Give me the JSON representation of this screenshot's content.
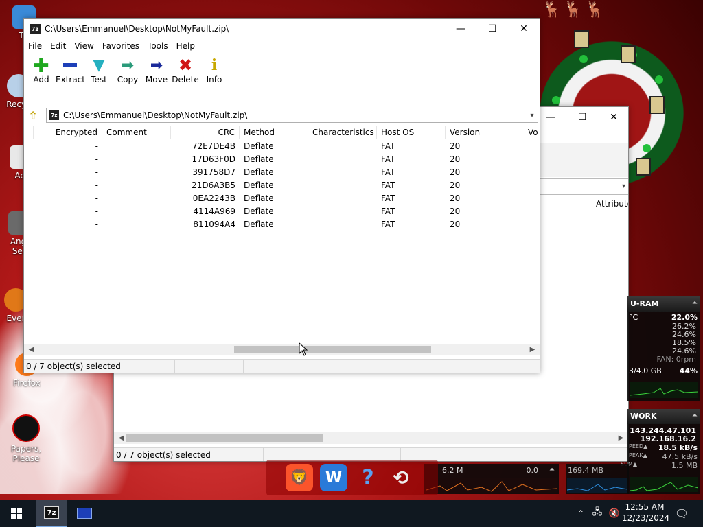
{
  "desktop": {
    "icons": [
      {
        "label": "Th"
      },
      {
        "label": "Recyc"
      },
      {
        "label": "Act"
      },
      {
        "label": "Angr"
      },
      {
        "label": "Sea"
      },
      {
        "label": "Ever"
      },
      {
        "label": "Firefox"
      },
      {
        "label": "Papers, Please"
      }
    ]
  },
  "front_window": {
    "title": "C:\\Users\\Emmanuel\\Desktop\\NotMyFault.zip\\",
    "logo": "7z",
    "menu": [
      "File",
      "Edit",
      "View",
      "Favorites",
      "Tools",
      "Help"
    ],
    "toolbar": [
      {
        "label": "Add",
        "icon": "plus-icon",
        "color": "#1fa81f"
      },
      {
        "label": "Extract",
        "icon": "minus-icon",
        "color": "#1d3fb8"
      },
      {
        "label": "Test",
        "icon": "check-icon",
        "color": "#25b0c0"
      },
      {
        "label": "Copy",
        "icon": "double-arrow-icon",
        "color": "#2a9a7a"
      },
      {
        "label": "Move",
        "icon": "arrow-right-icon",
        "color": "#1a2a9a"
      },
      {
        "label": "Delete",
        "icon": "x-icon",
        "color": "#d01818"
      },
      {
        "label": "Info",
        "icon": "info-icon",
        "color": "#c8a800"
      }
    ],
    "address": "C:\\Users\\Emmanuel\\Desktop\\NotMyFault.zip\\",
    "columns": [
      "Encrypted",
      "Comment",
      "CRC",
      "Method",
      "Characteristics",
      "Host OS",
      "Version",
      "Vo"
    ],
    "rows": [
      {
        "encrypted": "-",
        "comment": "",
        "crc": "72E7DE4B",
        "method": "Deflate",
        "characteristics": "",
        "host_os": "FAT",
        "version": "20"
      },
      {
        "encrypted": "-",
        "comment": "",
        "crc": "17D63F0D",
        "method": "Deflate",
        "characteristics": "",
        "host_os": "FAT",
        "version": "20"
      },
      {
        "encrypted": "-",
        "comment": "",
        "crc": "391758D7",
        "method": "Deflate",
        "characteristics": "",
        "host_os": "FAT",
        "version": "20"
      },
      {
        "encrypted": "-",
        "comment": "",
        "crc": "21D6A3B5",
        "method": "Deflate",
        "characteristics": "",
        "host_os": "FAT",
        "version": "20"
      },
      {
        "encrypted": "-",
        "comment": "",
        "crc": "0EA2243B",
        "method": "Deflate",
        "characteristics": "",
        "host_os": "FAT",
        "version": "20"
      },
      {
        "encrypted": "-",
        "comment": "",
        "crc": "4114A969",
        "method": "Deflate",
        "characteristics": "",
        "host_os": "FAT",
        "version": "20"
      },
      {
        "encrypted": "-",
        "comment": "",
        "crc": "811094A4",
        "method": "Deflate",
        "characteristics": "",
        "host_os": "FAT",
        "version": "20"
      }
    ],
    "status": "0 / 7 object(s) selected"
  },
  "back_window": {
    "column_partial": "Attribute",
    "status": "0 / 7 object(s) selected"
  },
  "gadgets": {
    "cpu_ram": {
      "title": "U-RAM",
      "temp_unit": "°C",
      "total": "22.0%",
      "cores": [
        "26.2%",
        "24.6%",
        "18.5%",
        "24.6%"
      ],
      "fan": "FAN: 0rpm",
      "memory": "3/4.0 GB",
      "memory_pct": "44%"
    },
    "network": {
      "title": "WORK",
      "ip_public": "143.244.47.101",
      "ip_local": "192.168.16.2",
      "speed_label": "PEED▲",
      "speed": "18.5 kB/s",
      "peak_label": "PEAK▲",
      "peak": "47.5 kB/s",
      "sum_label": "SUM▲",
      "sum": "1.5 MB",
      "down_total": "169.4 MB"
    },
    "disk": {
      "read": "6.2 M",
      "write": "0.0"
    }
  },
  "taskbar": {
    "time": "12:55 AM",
    "date": "12/23/2024"
  }
}
